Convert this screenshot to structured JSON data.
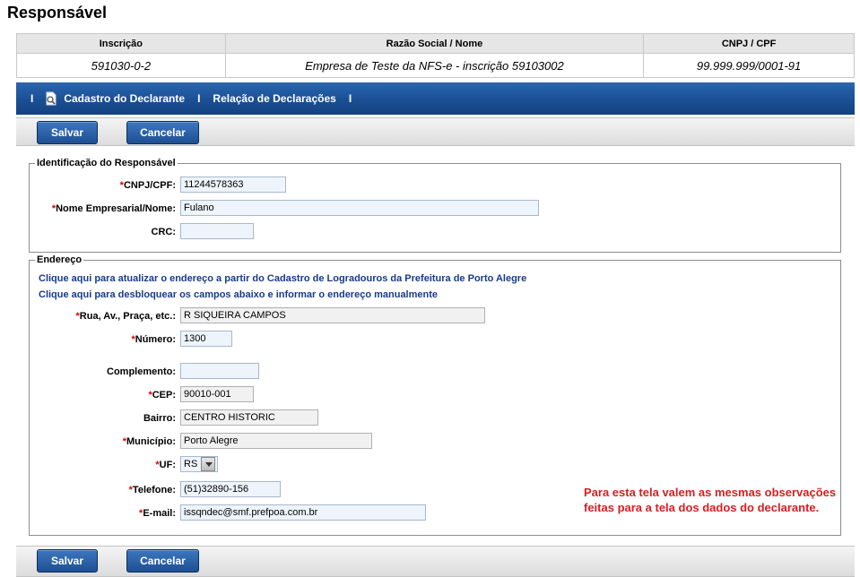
{
  "page": {
    "title": "Responsável"
  },
  "info_table": {
    "headers": [
      "Inscrição",
      "Razão Social / Nome",
      "CNPJ / CPF"
    ],
    "row": [
      "591030-0-2",
      "Empresa de Teste da NFS-e - inscrição 59103002",
      "99.999.999/0001-91"
    ]
  },
  "nav": {
    "separator": "I",
    "items": [
      {
        "label": "Cadastro do Declarante",
        "icon": "document-search-icon"
      },
      {
        "label": "Relação de Declarações"
      }
    ]
  },
  "toolbar": {
    "save_label": "Salvar",
    "cancel_label": "Cancelar"
  },
  "identificacao": {
    "legend": "Identificação do Responsável",
    "required_mark": "*",
    "fields": {
      "cnpj": {
        "label": "CNPJ/CPF:",
        "value": "11244578363"
      },
      "nome": {
        "label": "Nome Empresarial/Nome:",
        "value": "Fulano"
      },
      "crc": {
        "label": "CRC:",
        "value": ""
      }
    }
  },
  "endereco": {
    "legend": "Endereço",
    "links": [
      "Clique aqui para atualizar o endereço a partir do Cadastro de Logradouros da Prefeitura de Porto Alegre",
      "Clique aqui para desbloquear os campos abaixo e informar o endereço manualmente"
    ],
    "fields": {
      "rua": {
        "label": "Rua, Av., Praça, etc.:",
        "value": "R SIQUEIRA CAMPOS"
      },
      "numero": {
        "label": "Número:",
        "value": "1300"
      },
      "complemento": {
        "label": "Complemento:",
        "value": ""
      },
      "cep": {
        "label": "CEP:",
        "value": "90010-001"
      },
      "bairro": {
        "label": "Bairro:",
        "value": "CENTRO HISTORIC"
      },
      "municipio": {
        "label": "Município:",
        "value": "Porto Alegre"
      },
      "uf": {
        "label": "UF:",
        "value": "RS"
      },
      "telefone": {
        "label": "Telefone:",
        "value": "(51)32890-156"
      },
      "email": {
        "label": "E-mail:",
        "value": "issqndec@smf.prefpoa.com.br"
      }
    }
  },
  "note": {
    "text": "Para esta tela valem as mesmas observações feitas para a tela dos dados do declarante."
  },
  "colors": {
    "nav_blue": "#1a4f94",
    "required_red": "#dd0000",
    "note_red": "#d62020",
    "link_blue": "#1a3a8c"
  }
}
